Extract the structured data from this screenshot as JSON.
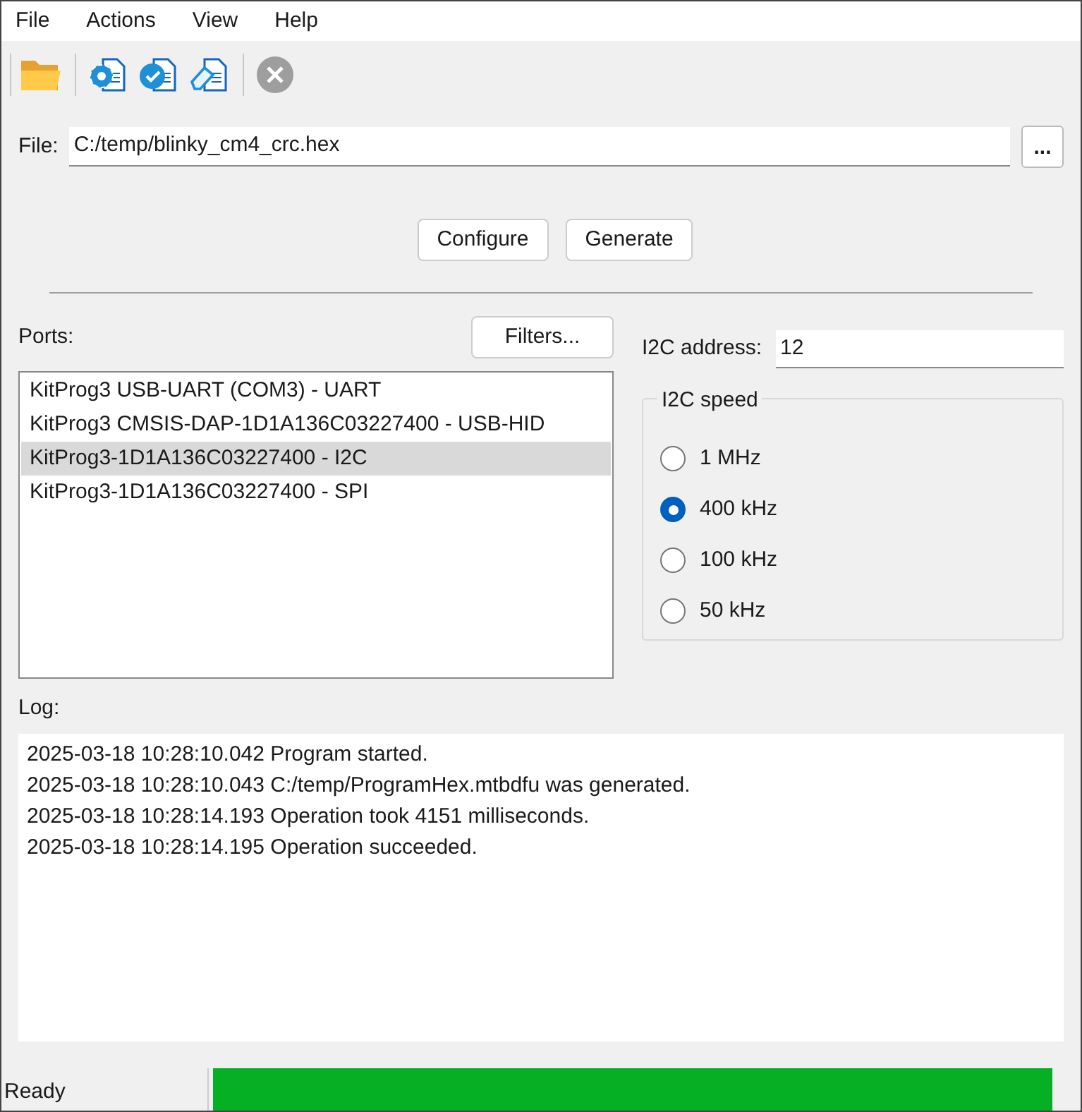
{
  "menu": [
    "File",
    "Actions",
    "View",
    "Help"
  ],
  "toolbar": [
    {
      "kind": "open"
    },
    {
      "kind": "configure"
    },
    {
      "kind": "generate"
    },
    {
      "kind": "erase"
    },
    {
      "kind": "stop",
      "disabled": true
    }
  ],
  "file": {
    "label": "File:",
    "value": "C:/temp/blinky_cm4_crc.hex",
    "browse": "..."
  },
  "actions": [
    "Configure",
    "Generate"
  ],
  "ports": {
    "label": "Ports:",
    "filters": "Filters...",
    "items": [
      {
        "text": "KitProg3 USB-UART (COM3) - UART",
        "selected": false
      },
      {
        "text": "KitProg3 CMSIS-DAP-1D1A136C03227400 - USB-HID",
        "selected": false
      },
      {
        "text": "KitProg3-1D1A136C03227400 - I2C",
        "selected": true
      },
      {
        "text": "KitProg3-1D1A136C03227400 - SPI",
        "selected": false
      }
    ]
  },
  "i2c_address": {
    "label": "I2C address:",
    "value": "12"
  },
  "i2c_speed": {
    "title": "I2C speed",
    "options": [
      {
        "label": "1 MHz",
        "selected": false
      },
      {
        "label": "400 kHz",
        "selected": true
      },
      {
        "label": "100 kHz",
        "selected": false
      },
      {
        "label": "50 kHz",
        "selected": false
      }
    ]
  },
  "log": {
    "label": "Log:",
    "lines": [
      "2025-03-18 10:28:10.042 Program started.",
      "2025-03-18 10:28:10.043 C:/temp/ProgramHex.mtbdfu was generated.",
      "2025-03-18 10:28:14.193 Operation took 4151 milliseconds.",
      "2025-03-18 10:28:14.195 Operation succeeded."
    ]
  },
  "status_bar": {
    "text": "Ready",
    "progress": {
      "level": 1
    }
  }
}
